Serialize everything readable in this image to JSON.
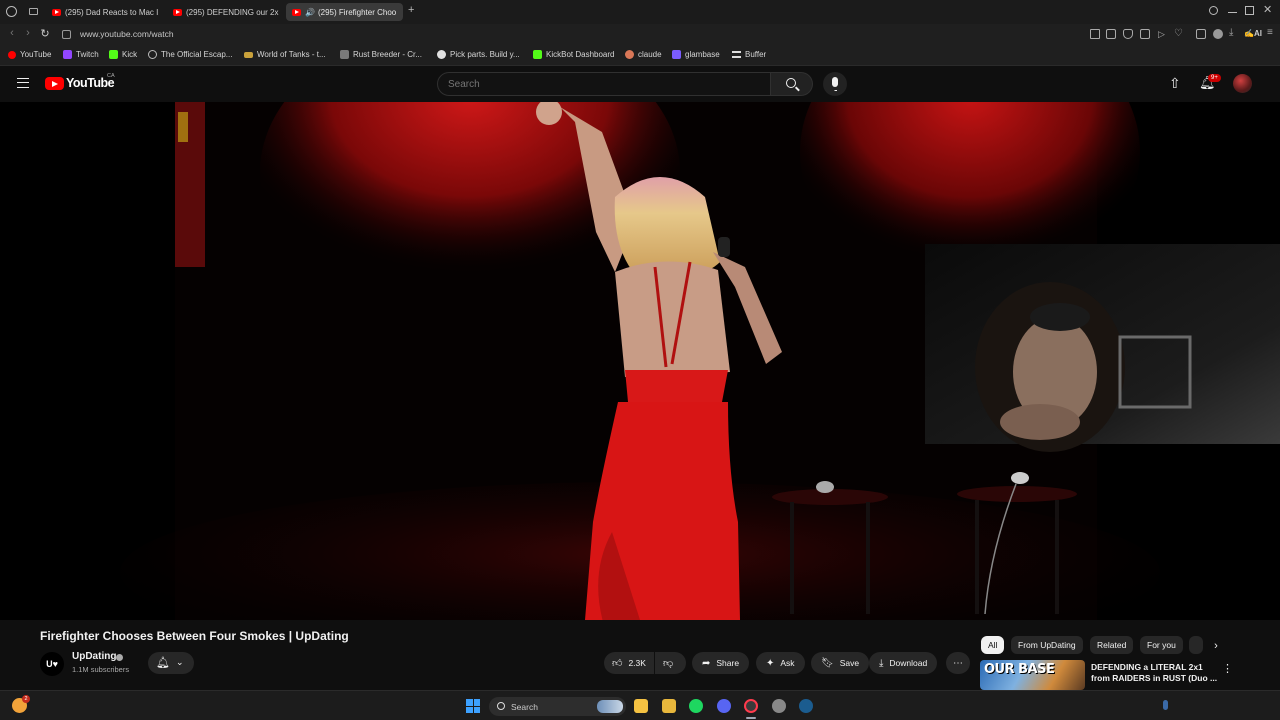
{
  "browser": {
    "tabs": [
      {
        "label": "(295) Dad Reacts to Mac I",
        "active": false
      },
      {
        "label": "(295) DEFENDING our 2x",
        "active": false
      },
      {
        "label": "(295) Firefighter Choo",
        "active": true
      }
    ],
    "new_tab": "+",
    "url": "www.youtube.com/watch",
    "bookmarks": [
      {
        "label": "YouTube",
        "icon": "youtube-icon",
        "color": "#ff0000"
      },
      {
        "label": "Twitch",
        "icon": "twitch-icon",
        "color": "#9146ff"
      },
      {
        "label": "Kick",
        "icon": "kick-icon",
        "color": "#53fc18"
      },
      {
        "label": "The Official Escap...",
        "icon": "gear-icon",
        "color": "#bbbbbb"
      },
      {
        "label": "World of Tanks - t...",
        "icon": "tank-icon",
        "color": "#c9a13b"
      },
      {
        "label": "Rust Breeder - Cr...",
        "icon": "plant-icon",
        "color": "#9c9c9c"
      },
      {
        "label": "Pick parts. Build y...",
        "icon": "pcpartpicker-icon",
        "color": "#e0e0e0"
      },
      {
        "label": "KickBot Dashboard",
        "icon": "kickbot-icon",
        "color": "#53fc18"
      },
      {
        "label": "claude",
        "icon": "claude-icon",
        "color": "#d97757"
      },
      {
        "label": "glambase",
        "icon": "glambase-icon",
        "color": "#7b5cff"
      },
      {
        "label": "Buffer",
        "icon": "buffer-icon",
        "color": "#dddddd"
      }
    ]
  },
  "youtube": {
    "wordmark": "YouTube",
    "region": "CA",
    "search": {
      "placeholder": "Search"
    },
    "notifications_badge": "9+",
    "video": {
      "title": "Firefighter Chooses Between Four Smokes | UpDating",
      "channel": {
        "initials": "U♥",
        "name": "UpDating",
        "subscribers": "1.1M subscribers"
      },
      "actions": {
        "likes": "2.3K",
        "share": "Share",
        "ask": "Ask",
        "save": "Save",
        "download": "Download"
      }
    },
    "chips": [
      "All",
      "From UpDating",
      "Related",
      "For you"
    ],
    "recommendation": {
      "thumb_text": "OUR BASE",
      "title": "DEFENDING a LITERAL 2x1 from RAIDERS in RUST (Duo ..."
    }
  },
  "taskbar": {
    "search_label": "Search",
    "notif_count": "2"
  },
  "colors": {
    "accent_red": "#ff0000",
    "background": "#0f0f0f",
    "chip_bg": "#272727"
  }
}
